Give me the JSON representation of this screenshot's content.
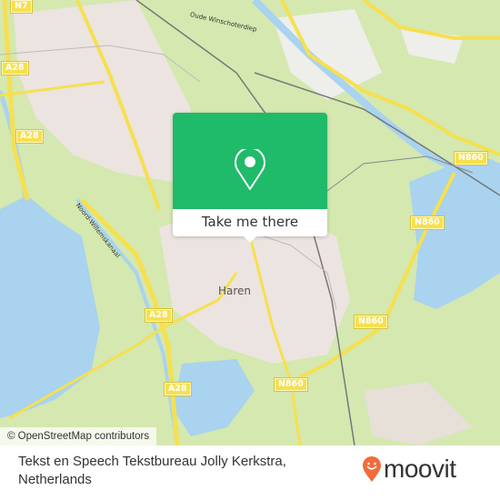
{
  "map": {
    "place_labels": [
      {
        "name": "Haren"
      }
    ],
    "water_labels": [
      {
        "name": "Oude Winschoterdiep"
      },
      {
        "name": "Noord-Willemskanaal"
      }
    ],
    "road_shields": [
      "N7",
      "A28",
      "A28",
      "A28",
      "A28",
      "N860",
      "N860",
      "N860",
      "N860"
    ],
    "attribution": "© OpenStreetMap contributors",
    "colors": {
      "land": "#d4e8b0",
      "urban": "#ece4e0",
      "water": "#a9d3ef",
      "road": "#f6e04f",
      "accent": "#1fba6a"
    }
  },
  "popup": {
    "icon": "map-pin-icon",
    "button_label": "Take me there"
  },
  "footer": {
    "place_name": "Tekst en Speech Tekstbureau Jolly Kerkstra, Netherlands",
    "logo_text": "moovit",
    "logo_icon": "moovit-smile-pin-icon",
    "logo_color": "#f26b3a"
  }
}
